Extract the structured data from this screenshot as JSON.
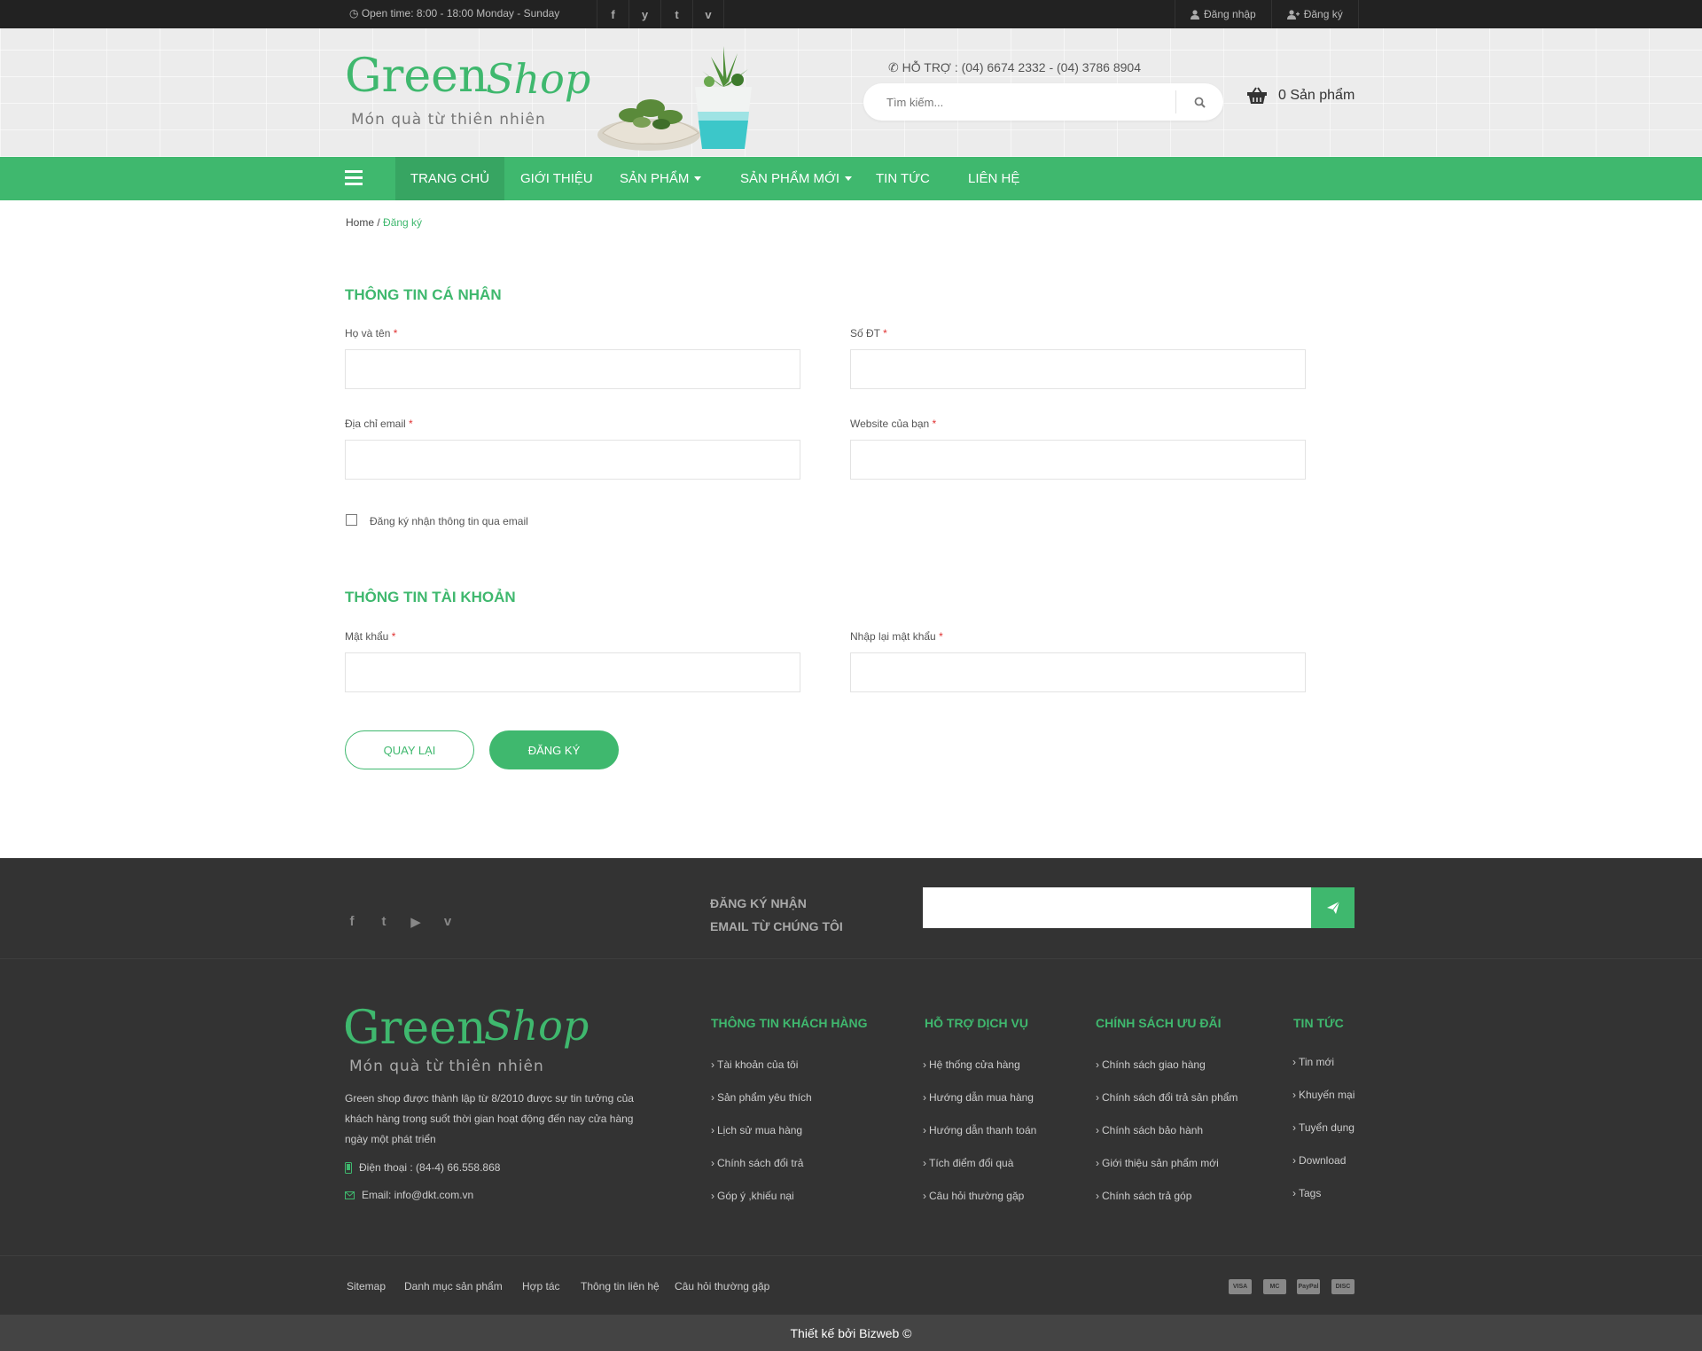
{
  "topbar": {
    "open_time": "Open time: 8:00 - 18:00   Monday - Sunday",
    "social": [
      "f",
      "y",
      "t",
      "v"
    ],
    "login": "Đăng nhập",
    "register": "Đăng ký"
  },
  "header": {
    "logo_word1": "Green",
    "logo_word2": "Shop",
    "logo_tagline": "Món quà từ thiên nhiên",
    "support_label": "HỖ TRỢ :",
    "support_phones": "(04) 6674 2332 - (04) 3786 8904",
    "search_placeholder": "Tìm kiếm...",
    "cart_text": "0 Sản phẩm"
  },
  "nav": {
    "items": [
      {
        "label": "TRANG CHỦ"
      },
      {
        "label": "GIỚI THIỆU"
      },
      {
        "label": "SẢN PHẨM"
      },
      {
        "label": "SẢN PHẨM MỚI"
      },
      {
        "label": "TIN TỨC"
      },
      {
        "label": "LIÊN HỆ"
      }
    ]
  },
  "breadcrumb": {
    "home": "Home",
    "sep": " / ",
    "current": "Đăng ký"
  },
  "form": {
    "personal_title": "THÔNG TIN CÁ NHÂN",
    "name_label": "Họ và tên",
    "phone_label": "Số ĐT",
    "email_label": "Địa chỉ email",
    "website_label": "Website của bạn",
    "required_mark": "*",
    "newsletter_label": "Đăng ký nhận thông tin qua email",
    "account_title": "THÔNG TIN TÀI KHOẢN",
    "password_label": "Mật khẩu",
    "password_confirm_label": "Nhập lại mật khẩu",
    "back_button": "QUAY LẠI",
    "submit_button": "ĐĂNG KÝ"
  },
  "footer": {
    "social": [
      "f",
      "t",
      "▶",
      "v"
    ],
    "newsletter_line1": "ĐĂNG KÝ NHẬN",
    "newsletter_line2": "EMAIL TỪ CHÚNG TÔI",
    "description": "Green shop được thành lập từ 8/2010 được sự tin tưởng của khách hàng trong suốt thời gian hoạt động đến nay cửa hàng ngày một phát triển",
    "phone": "Điện thoại : (84-4) 66.558.868",
    "email": "Email: info@dkt.com.vn",
    "columns": [
      {
        "title": "THÔNG TIN KHÁCH HÀNG",
        "items": [
          "Tài khoản của tôi",
          "Sản phẩm yêu thích",
          "Lịch sử mua hàng",
          "Chính sách đổi trả",
          "Góp ý ,khiếu nại"
        ]
      },
      {
        "title": "HỖ TRỢ DỊCH VỤ",
        "items": [
          "Hệ thống cửa hàng",
          "Hướng dẫn mua hàng",
          "Hướng dẫn thanh toán",
          "Tích điểm đổi quà",
          "Câu hỏi thường gặp"
        ]
      },
      {
        "title": "CHÍNH SÁCH ƯU ĐÃI",
        "items": [
          "Chính sách giao hàng",
          "Chính sách đổi trả sản phẩm",
          "Chính sách bảo hành",
          "Giới thiệu sản phẩm mới",
          "Chính sách trả góp"
        ]
      },
      {
        "title": "TIN TỨC",
        "items": [
          "Tin mới",
          "Khuyến mại",
          "Tuyển dụng",
          "Download",
          "Tags"
        ]
      }
    ],
    "bottom_links": [
      "Sitemap",
      "Danh mục sản phẩm",
      "Hợp tác",
      "Thông tin liên hệ",
      "Câu hỏi thường gặp"
    ],
    "payments": [
      "VISA",
      "MC",
      "PayPal",
      "DISC"
    ],
    "credit": "Thiết kế  bởi Bizweb ©"
  },
  "colors": {
    "brand": "#3fb86e",
    "dark": "#333333",
    "topbar": "#222222"
  }
}
